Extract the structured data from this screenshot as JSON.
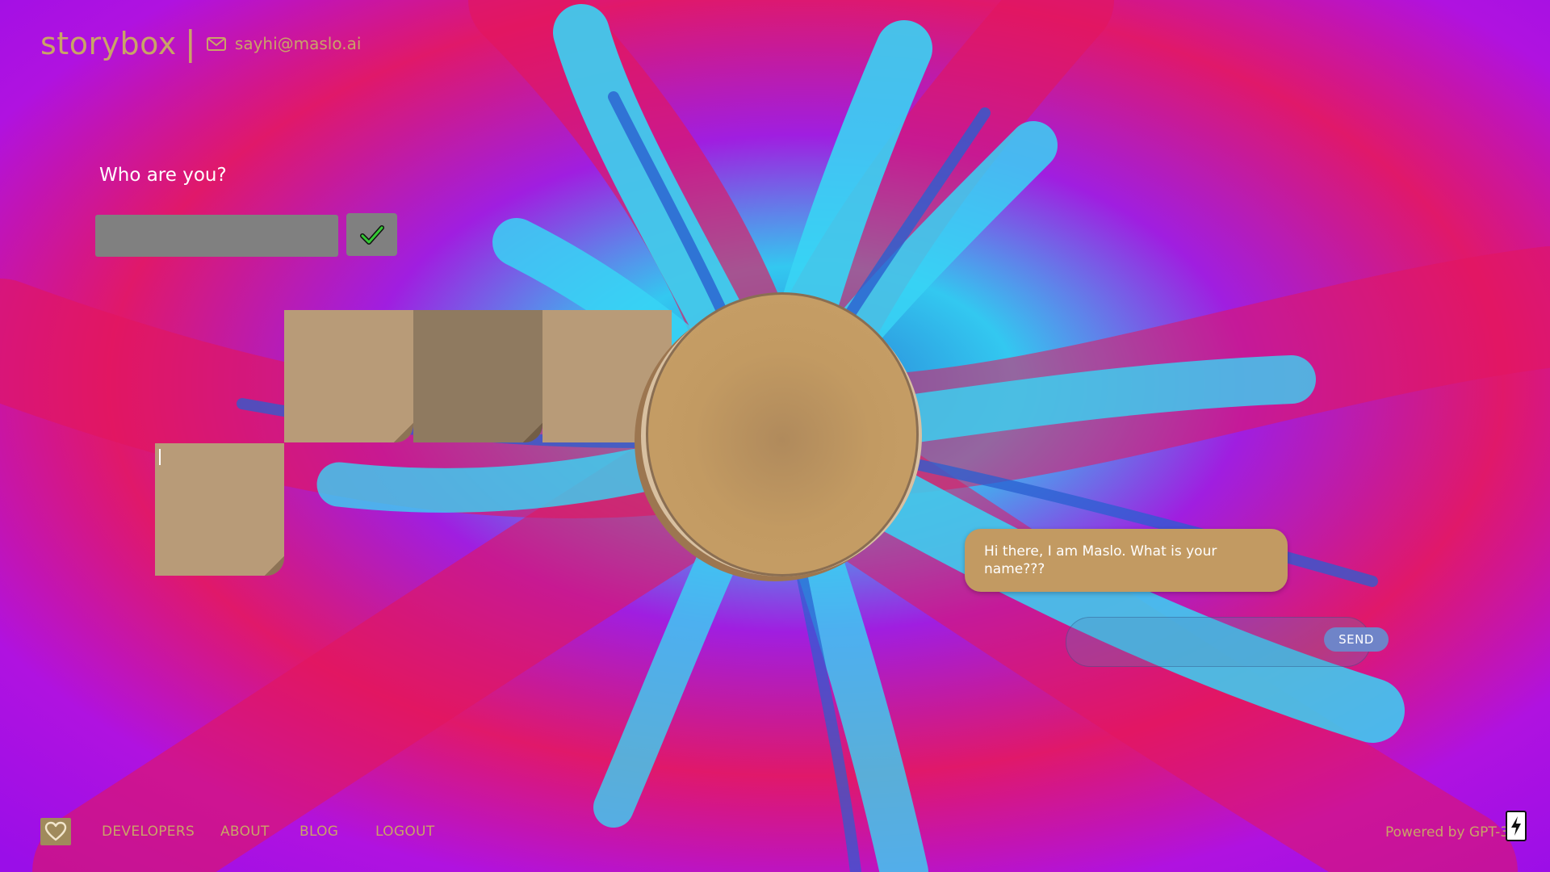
{
  "header": {
    "brand": "storybox",
    "separator": "|",
    "email": "sayhi@maslo.ai",
    "email_icon": "mail-icon"
  },
  "identity": {
    "prompt": "Who are you?",
    "input_value": "",
    "confirm_icon": "checkmark-icon"
  },
  "chat": {
    "message": "Hi there, I am Maslo. What is your name???",
    "input_value": "",
    "send_label": "SEND"
  },
  "footer": {
    "heart_icon": "heart-icon",
    "nav": [
      "DEVELOPERS",
      "ABOUT",
      "BLOG",
      "LOGOUT"
    ],
    "powered_by": "Powered by GPT-3",
    "bolt_icon": "lightning-bolt-icon"
  },
  "colors": {
    "accent": "#c9a467",
    "bubble": "#c29a62",
    "send": "#6f84c8",
    "tile_light": "#b89b78",
    "tile_dark": "#8f7a60"
  }
}
